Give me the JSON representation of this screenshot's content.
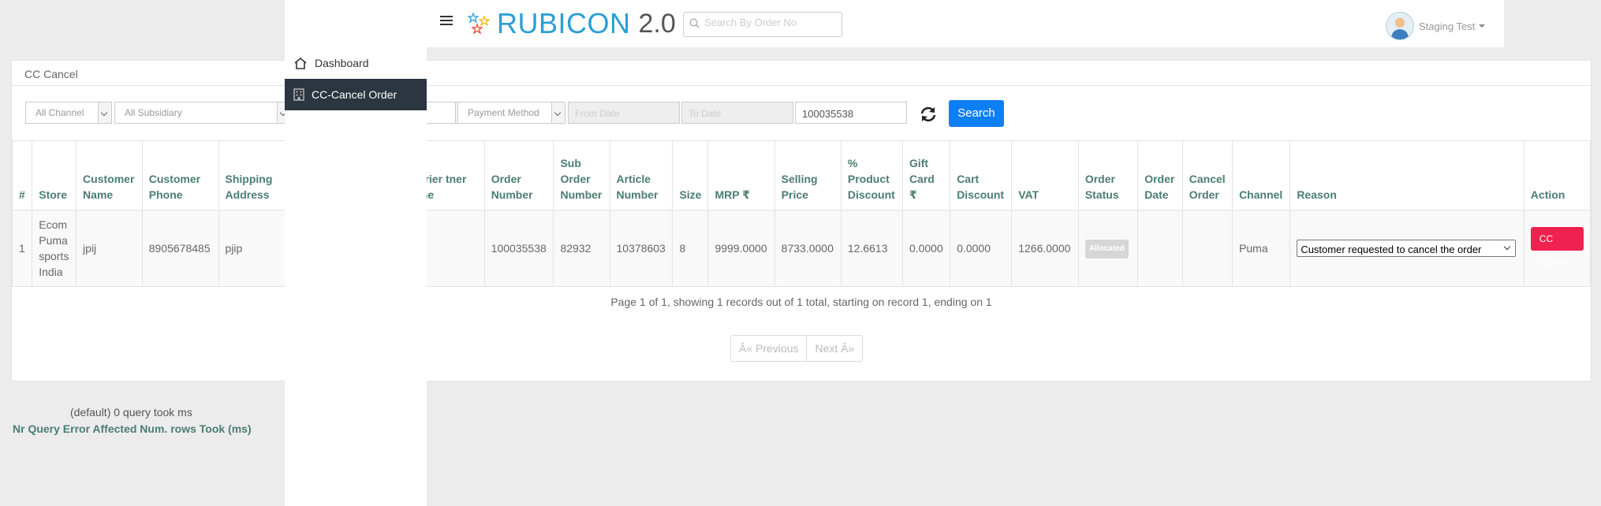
{
  "header": {
    "logo_text": "RUBICON",
    "logo_version": "2.0",
    "search_placeholder": "Search By Order No",
    "user_name": "Staging Test"
  },
  "sidebar": {
    "items": [
      {
        "label": "Dashboard",
        "icon": "home-icon",
        "active": false
      },
      {
        "label": "CC-Cancel Order",
        "icon": "building-icon",
        "active": true
      }
    ]
  },
  "panel": {
    "title": "CC Cancel"
  },
  "filters": {
    "channel": "All Channel",
    "subsidiary": "All Subsidiary",
    "payment_method": "Payment Method",
    "from_date_placeholder": "From Date",
    "to_date_placeholder": "To Date",
    "order_no": "100035538",
    "search_label": "Search"
  },
  "table": {
    "headers": [
      "#",
      "Store",
      "Customer Name",
      "Customer Phone",
      "Shipping Address",
      "urier tner me",
      "Order Number",
      "Sub Order Number",
      "Article Number",
      "Size",
      "MRP ₹",
      "Selling Price",
      "% Product Discount",
      "Gift Card ₹",
      "Cart Discount",
      "VAT",
      "Order Status",
      "Order Date",
      "Cancel Order",
      "Channel",
      "Reason",
      "Action"
    ],
    "row": {
      "num": "1",
      "store": "Ecom Puma sports India",
      "customer_name": "jpij",
      "customer_phone": "8905678485",
      "shipping_address": "pjip",
      "courier": "",
      "order_number": "100035538",
      "sub_order_number": "82932",
      "article_number": "10378603",
      "size": "8",
      "mrp": "9999.0000",
      "selling_price": "8733.0000",
      "product_discount": "12.6613",
      "gift_card": "0.0000",
      "cart_discount": "0.0000",
      "vat": "1266.0000",
      "order_status": "Allocated",
      "order_date": "",
      "cancel_order": "",
      "channel": "Puma",
      "reason": "Customer requested to cancel the order",
      "action_label": "CC Cancel"
    }
  },
  "pagination": {
    "info": "Page 1 of 1, showing 1 records out of 1 total, starting on record 1, ending on 1",
    "previous": "Â« Previous",
    "next": "Next Â»"
  },
  "query_log": {
    "summary": "(default) 0 query took ms",
    "columns": "Nr Query Error Affected Num. rows Took (ms)"
  },
  "colors": {
    "brand_blue": "#2a9fd6",
    "search_button": "#0d7ff4",
    "cancel_button": "#f0214e",
    "sidebar_active": "#2c3640",
    "header_text": "#4b7d72"
  }
}
